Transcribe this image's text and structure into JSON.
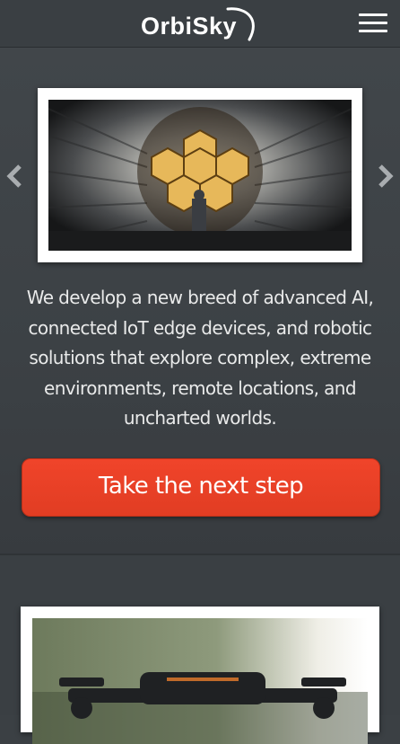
{
  "header": {
    "logo_text": "OrbiSky",
    "menu_icon": "hamburger-menu-icon"
  },
  "hero": {
    "prev_icon": "chevron-left-icon",
    "next_icon": "chevron-right-icon",
    "tagline_lines": [
      "We develop a new breed of advanced AI,",
      "connected IoT edge devices, and robotic",
      "solutions that explore complex, extreme",
      "environments, remote locations, and",
      "uncharted worlds."
    ],
    "cta_label": "Take the next step"
  },
  "colors": {
    "background": "#3b4044",
    "cta": "#ea4127",
    "text": "#e9eaea",
    "frame": "#ffffff"
  }
}
